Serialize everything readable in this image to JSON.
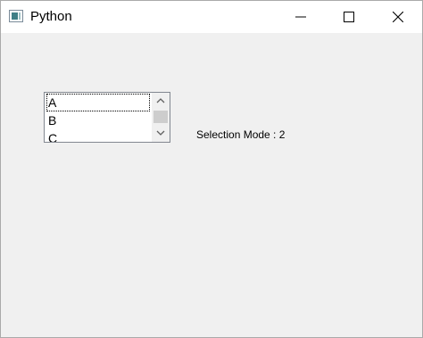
{
  "window": {
    "title": "Python",
    "icon": "python-app-icon",
    "controls": {
      "minimize": "minimize-icon",
      "maximize": "maximize-icon",
      "close": "close-icon"
    }
  },
  "listbox": {
    "items": [
      "A",
      "B",
      "C"
    ],
    "focused_item": "A",
    "scrollbar": {
      "up": "chevron-up-icon",
      "down": "chevron-down-icon"
    }
  },
  "status": {
    "mode_text": "Selection Mode : 2"
  }
}
